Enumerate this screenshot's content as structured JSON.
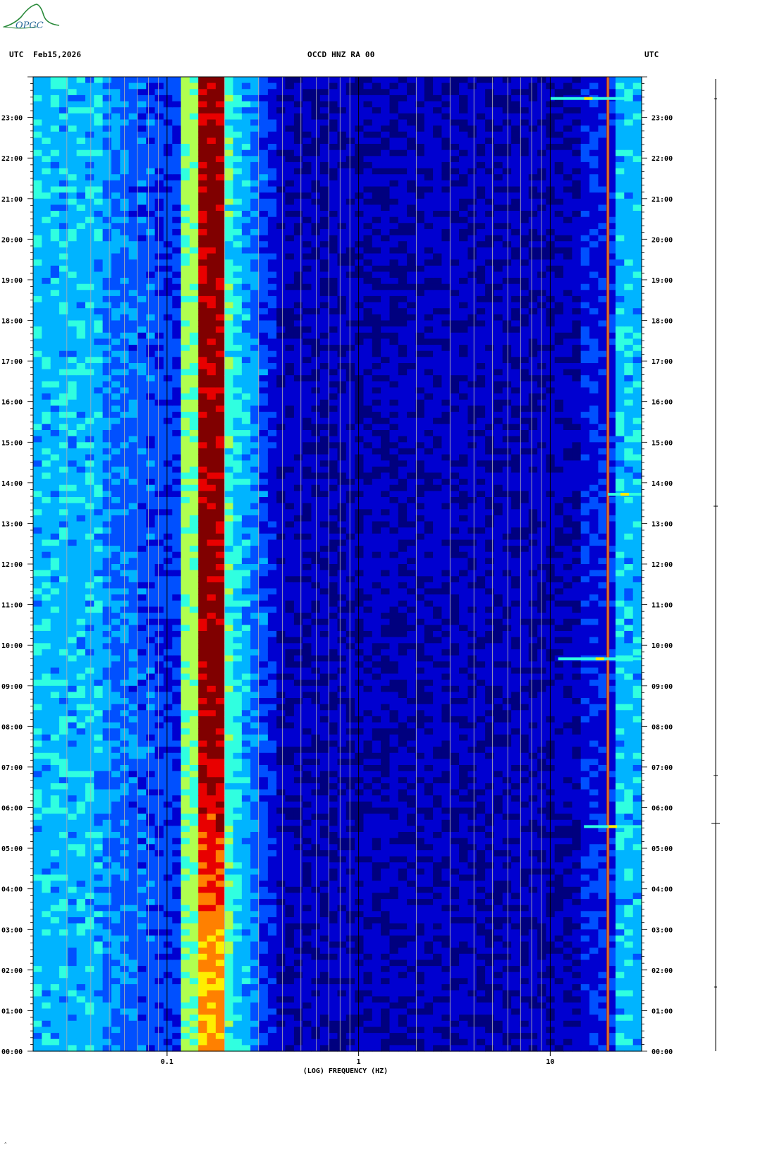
{
  "logo": {
    "text": "OPGC",
    "color": "#2a8a3a"
  },
  "header": {
    "left_utc": "UTC",
    "date": "Feb15,2026",
    "station": "OCCD HNZ RA 00",
    "right_utc": "UTC"
  },
  "footer_mark": "^",
  "chart_data": {
    "type": "heatmap",
    "title": "OCCD HNZ RA 00",
    "xlabel": "(LOG) FREQUENCY (HZ)",
    "ylabel": "",
    "x_scale": "log",
    "x_tick_labels": [
      "0.1",
      "1",
      "10"
    ],
    "x_ticks": [
      0.1,
      1,
      10
    ],
    "xlim": [
      0.02,
      30
    ],
    "y_tick_labels": [
      "00:00",
      "01:00",
      "02:00",
      "03:00",
      "04:00",
      "05:00",
      "06:00",
      "07:00",
      "08:00",
      "09:00",
      "10:00",
      "11:00",
      "12:00",
      "13:00",
      "14:00",
      "15:00",
      "16:00",
      "17:00",
      "18:00",
      "19:00",
      "20:00",
      "21:00",
      "22:00",
      "23:00"
    ],
    "ylim_hours": [
      0,
      24
    ],
    "colormap": [
      "#00007f",
      "#0000d0",
      "#0050ff",
      "#00b4ff",
      "#30ffe0",
      "#b0ff50",
      "#ffee00",
      "#ff8000",
      "#e80000",
      "#800000"
    ],
    "dominant_features": {
      "microseism_band_hz": [
        0.13,
        0.2
      ],
      "persistent_line_hz": 20,
      "high_freq_band_hz": [
        22,
        30
      ]
    },
    "events": [
      {
        "time": "05:32",
        "freq_range_hz": [
          15,
          30
        ]
      },
      {
        "time": "09:40",
        "freq_range_hz": [
          11,
          30
        ]
      },
      {
        "time": "13:43",
        "freq_range_hz": [
          20,
          30
        ]
      },
      {
        "time": "23:28",
        "freq_range_hz": [
          10,
          25
        ]
      }
    ]
  }
}
